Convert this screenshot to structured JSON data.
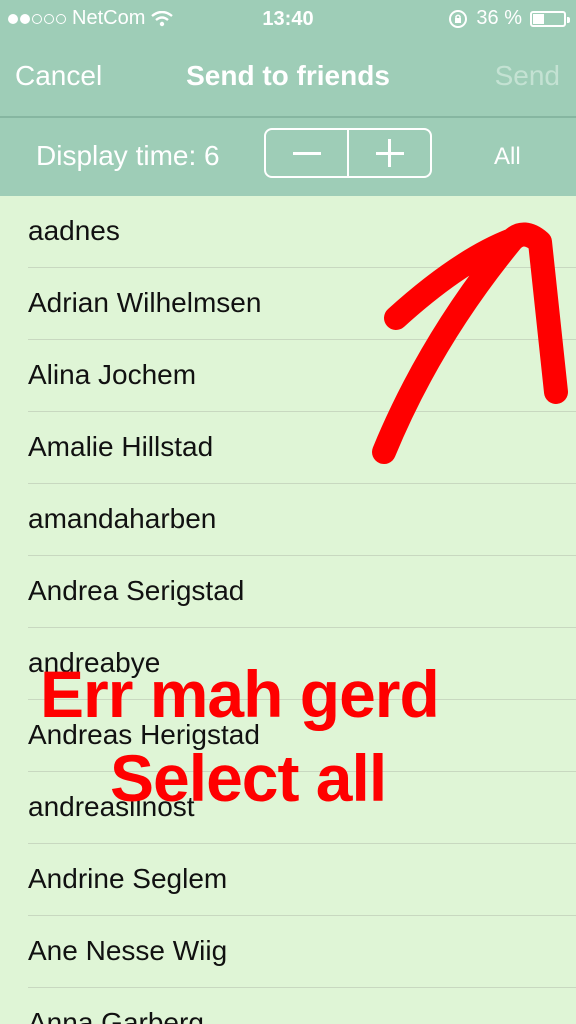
{
  "statusbar": {
    "carrier": "NetCom",
    "time": "13:40",
    "battery_text": "36 %",
    "battery_level": 0.36
  },
  "navbar": {
    "cancel_label": "Cancel",
    "title": "Send to friends",
    "send_label": "Send"
  },
  "toolbar": {
    "display_time_label": "Display time: 6",
    "all_label": "All"
  },
  "friends": [
    "aadnes",
    "Adrian Wilhelmsen",
    "Alina Jochem",
    "Amalie Hillstad",
    "amandaharben",
    "Andrea Serigstad",
    "andreabye",
    "Andreas Herigstad",
    "andreasilnost",
    "Andrine Seglem",
    "Ane Nesse Wiig",
    "Anna Garberg"
  ],
  "annotation": {
    "line1": "Err mah gerd",
    "line2": "Select all",
    "color": "#ff0000"
  },
  "colors": {
    "bar": "#9ecdb7",
    "list_bg": "#dff5d6"
  }
}
